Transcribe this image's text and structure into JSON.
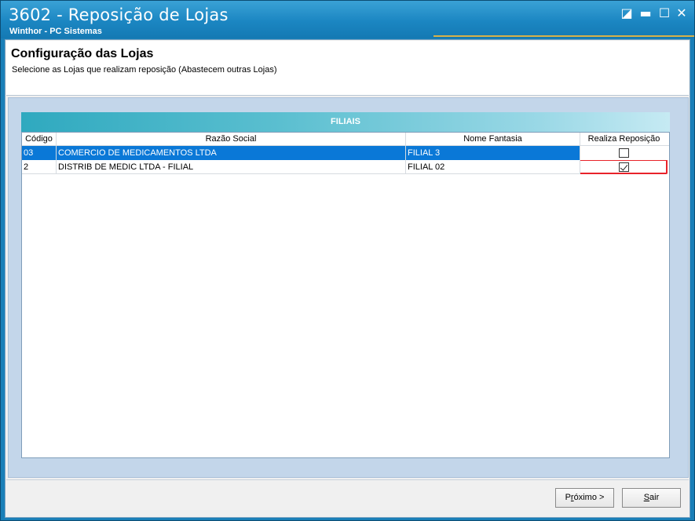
{
  "window": {
    "title": "3602 - Reposição de Lojas",
    "subtitle": "Winthor - PC Sistemas",
    "controls": {
      "restore": "◪",
      "minimize": "▬",
      "maximize": "☐",
      "close": "✕"
    }
  },
  "header": {
    "title": "Configuração das Lojas",
    "subtitle": "Selecione as Lojas que realizam reposição (Abastecem outras Lojas)"
  },
  "grid": {
    "title": "FILIAIS",
    "columns": [
      "Código",
      "Razão Social",
      "Nome Fantasia",
      "Realiza Reposição"
    ],
    "rows": [
      {
        "codigo": "03",
        "razao_social": "COMERCIO DE MEDICAMENTOS LTDA",
        "nome_fantasia": "FILIAL 3",
        "realiza_reposicao": false,
        "selected": true
      },
      {
        "codigo": "2",
        "razao_social": "DISTRIB DE MEDIC LTDA - FILIAL",
        "nome_fantasia": "FILIAL 02",
        "realiza_reposicao": true,
        "selected": false
      }
    ]
  },
  "footer": {
    "next_label_prefix": "P",
    "next_label_underlined": "r",
    "next_label_suffix": "óximo >",
    "exit_label_underlined": "S",
    "exit_label_suffix": "air"
  },
  "colors": {
    "titlebar": "#1b86c2",
    "selected_row": "#0a78d7",
    "highlight": "#e8232a",
    "panel": "#c3d6ea"
  }
}
